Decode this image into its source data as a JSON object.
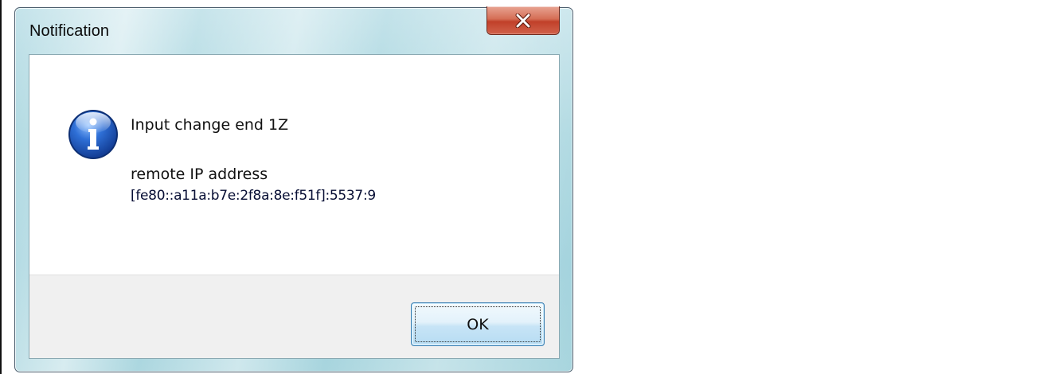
{
  "window": {
    "title": "Notification",
    "close_icon": "close-x-icon"
  },
  "message": {
    "icon": "information-icon",
    "line1": "Input change end 1Z",
    "line2": "remote IP address",
    "line3": "[fe80::a11a:b7e:2f8a:8e:f51f]:5537:9"
  },
  "buttons": {
    "ok_label": "OK"
  },
  "colors": {
    "title_bar": "#a9d6df",
    "close_button": "#c1402a",
    "button_area": "#f0f0f0",
    "ok_border": "#3c7fb1",
    "info_icon_blue": "#1f4fa8"
  }
}
